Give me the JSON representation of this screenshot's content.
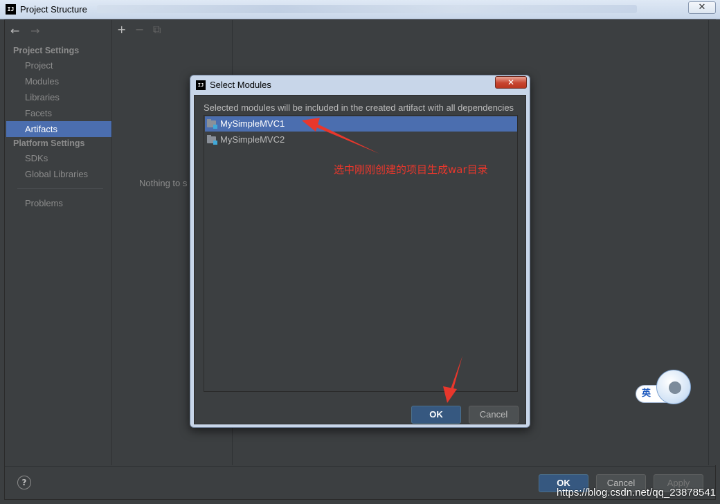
{
  "window": {
    "title": "Project Structure",
    "logo": "IJ",
    "close_glyph": "✕"
  },
  "sidebar": {
    "back_glyph": "←",
    "forward_glyph": "→",
    "project_settings_title": "Project Settings",
    "project_items": [
      "Project",
      "Modules",
      "Libraries",
      "Facets",
      "Artifacts"
    ],
    "selected_item": "Artifacts",
    "platform_settings_title": "Platform Settings",
    "platform_items": [
      "SDKs",
      "Global Libraries"
    ],
    "problems": "Problems"
  },
  "middle": {
    "add_glyph": "+",
    "remove_glyph": "−",
    "copy_glyph": "⧉",
    "empty_text": "Nothing to s"
  },
  "bottom": {
    "help_glyph": "?",
    "ok_label": "OK",
    "cancel_label": "Cancel",
    "apply_label": "Apply"
  },
  "dialog": {
    "title": "Select Modules",
    "logo": "IJ",
    "close_glyph": "✕",
    "description": "Selected modules will be included in the created artifact with all dependencies",
    "modules": [
      "MySimpleMVC1",
      "MySimpleMVC2"
    ],
    "selected_module": "MySimpleMVC1",
    "ok_label": "OK",
    "cancel_label": "Cancel"
  },
  "annotation": {
    "text": "选中刚刚创建的项目生成war目录",
    "color": "#e8372c"
  },
  "ime": {
    "label": "英"
  },
  "watermark": "https://blog.csdn.net/qq_23878541",
  "colors": {
    "selection": "#4b6eaf",
    "background": "#3c3f41",
    "primary_button": "#365880"
  }
}
